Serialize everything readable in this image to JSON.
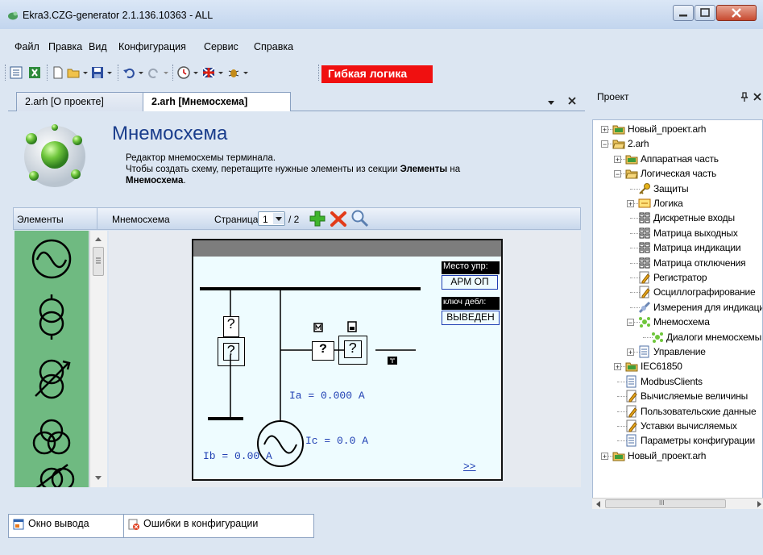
{
  "window": {
    "title": "Ekra3.CZG-generator 2.1.136.10363 - ALL"
  },
  "menu": [
    "Файл",
    "Правка",
    "Вид",
    "Конфигурация",
    "Сервис",
    "Справка"
  ],
  "toolbar": {
    "flex_logic_label": "Гибкая логика"
  },
  "doc_tabs": [
    {
      "label": "2.arh [О проекте]",
      "active": false
    },
    {
      "label": "2.arh [Мнемосхема]",
      "active": true
    }
  ],
  "header": {
    "title": "Мнемосхема",
    "line1": "Редактор мнемосхемы терминала.",
    "line2_pre": "Чтобы создать схему, перетащите нужные элементы из секции ",
    "line2_bold": "Элементы",
    "line2_post": " на",
    "line3_bold": "Мнемосхема",
    "line3_post": "."
  },
  "panel": {
    "elements_label": "Элементы",
    "mnemo_label": "Мнемосхема",
    "page_label": "Страница",
    "page_value": "1",
    "page_total": "/ 2"
  },
  "screen": {
    "mesto_label": "Место упр:",
    "mesto_value": "АРМ ОП",
    "key_label": "ключ дебл:",
    "key_value": "ВЫВЕДЕН",
    "q1": "?",
    "q2": "?",
    "q3": "?",
    "q4": "?",
    "m_label": "М",
    "ia": "Ia = 0.000 A",
    "ic": "Ic = 0.0 A",
    "ib": "Ib = 0.00 A",
    "next": ">>"
  },
  "project": {
    "title": "Проект",
    "pin": "ᵽ",
    "close": "×",
    "tree": [
      {
        "label": "Новый_проект.arh",
        "level": 0,
        "icon": "folder",
        "expander": "+"
      },
      {
        "label": "2.arh",
        "level": 0,
        "icon": "folder-open",
        "expander": "-"
      },
      {
        "label": "Аппаратная часть",
        "level": 1,
        "icon": "folder",
        "expander": "+"
      },
      {
        "label": "Логическая часть",
        "level": 1,
        "icon": "folder-open",
        "expander": "-"
      },
      {
        "label": "Защиты",
        "level": 2,
        "icon": "key",
        "expander": ""
      },
      {
        "label": "Логика",
        "level": 2,
        "icon": "logic",
        "expander": "+"
      },
      {
        "label": "Дискретные входы",
        "level": 2,
        "icon": "matrix",
        "expander": ""
      },
      {
        "label": "Матрица выходных",
        "level": 2,
        "icon": "matrix",
        "expander": ""
      },
      {
        "label": "Матрица индикации",
        "level": 2,
        "icon": "matrix",
        "expander": ""
      },
      {
        "label": "Матрица отключения",
        "level": 2,
        "icon": "matrix",
        "expander": ""
      },
      {
        "label": "Регистратор",
        "level": 2,
        "icon": "doc-edit",
        "expander": ""
      },
      {
        "label": "Осциллографирование",
        "level": 2,
        "icon": "doc-edit",
        "expander": ""
      },
      {
        "label": "Измерения для индикации",
        "level": 2,
        "icon": "measure",
        "expander": ""
      },
      {
        "label": "Мнемосхема",
        "level": 2,
        "icon": "mnemo",
        "expander": "-"
      },
      {
        "label": "Диалоги мнемосхемы",
        "level": 3,
        "icon": "mnemo",
        "expander": ""
      },
      {
        "label": "Управление",
        "level": 2,
        "icon": "doc",
        "expander": "+"
      },
      {
        "label": "IEC61850",
        "level": 1,
        "icon": "folder",
        "expander": "+"
      },
      {
        "label": "ModbusClients",
        "level": 1,
        "icon": "doc",
        "expander": ""
      },
      {
        "label": "Вычисляемые величины",
        "level": 1,
        "icon": "doc-edit",
        "expander": ""
      },
      {
        "label": "Пользовательские данные",
        "level": 1,
        "icon": "doc-edit",
        "expander": ""
      },
      {
        "label": "Уставки вычисляемых",
        "level": 1,
        "icon": "doc-edit",
        "expander": ""
      },
      {
        "label": "Параметры конфигурации",
        "level": 1,
        "icon": "doc",
        "expander": ""
      },
      {
        "label": "Новый_проект.arh",
        "level": 0,
        "icon": "folder",
        "expander": "+"
      }
    ],
    "hscroll_grip": "III"
  },
  "bottom_tabs": [
    {
      "label": "Окно вывода",
      "icon": "output-window-icon"
    },
    {
      "label": "Ошибки в конфигурации",
      "icon": "config-errors-icon"
    }
  ]
}
